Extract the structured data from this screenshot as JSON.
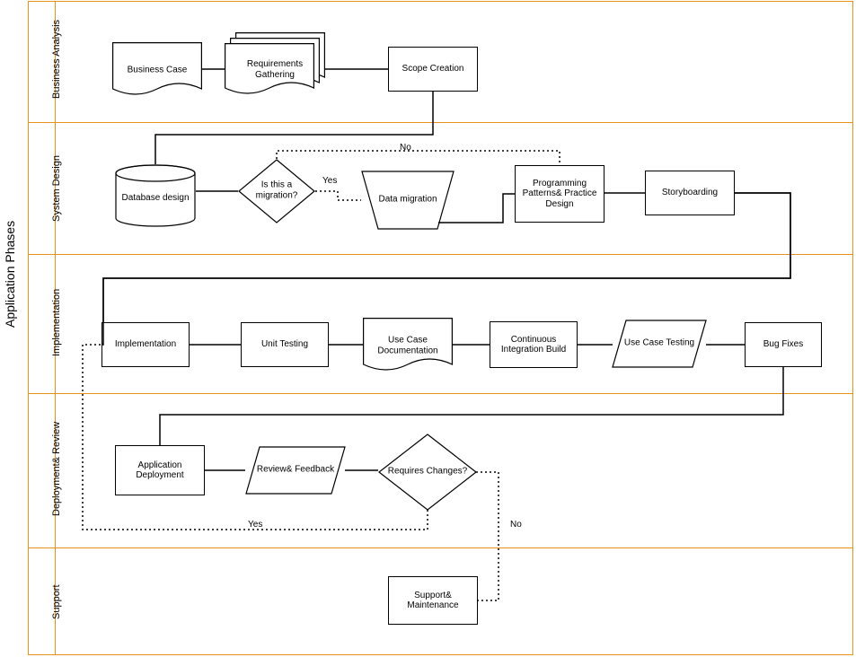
{
  "title": "Application Phases",
  "lanes": {
    "ba": "Business Analysis",
    "sd": "System Design",
    "impl": "Implementation",
    "dr": "Deployment& Review",
    "sup": "Support"
  },
  "nodes": {
    "business_case": "Business Case",
    "requirements": "Requirements Gathering",
    "scope_creation": "Scope Creation",
    "database_design": "Database design",
    "is_migration": "Is this a migration?",
    "data_migration": "Data migration",
    "patterns_practice": "Programming Patterns& Practice Design",
    "storyboarding": "Storyboarding",
    "implementation": "Implementation",
    "unit_testing": "Unit Testing",
    "use_case_doc": "Use Case Documentation",
    "ci_build": "Continuous Integration Build",
    "use_case_testing": "Use Case Testing",
    "bug_fixes": "Bug Fixes",
    "app_deployment": "Application Deployment",
    "review_feedback": "Review& Feedback",
    "requires_changes": "Requires Changes?",
    "support_maint": "Support& Maintenance"
  },
  "edges": {
    "yes": "Yes",
    "no": "No"
  }
}
